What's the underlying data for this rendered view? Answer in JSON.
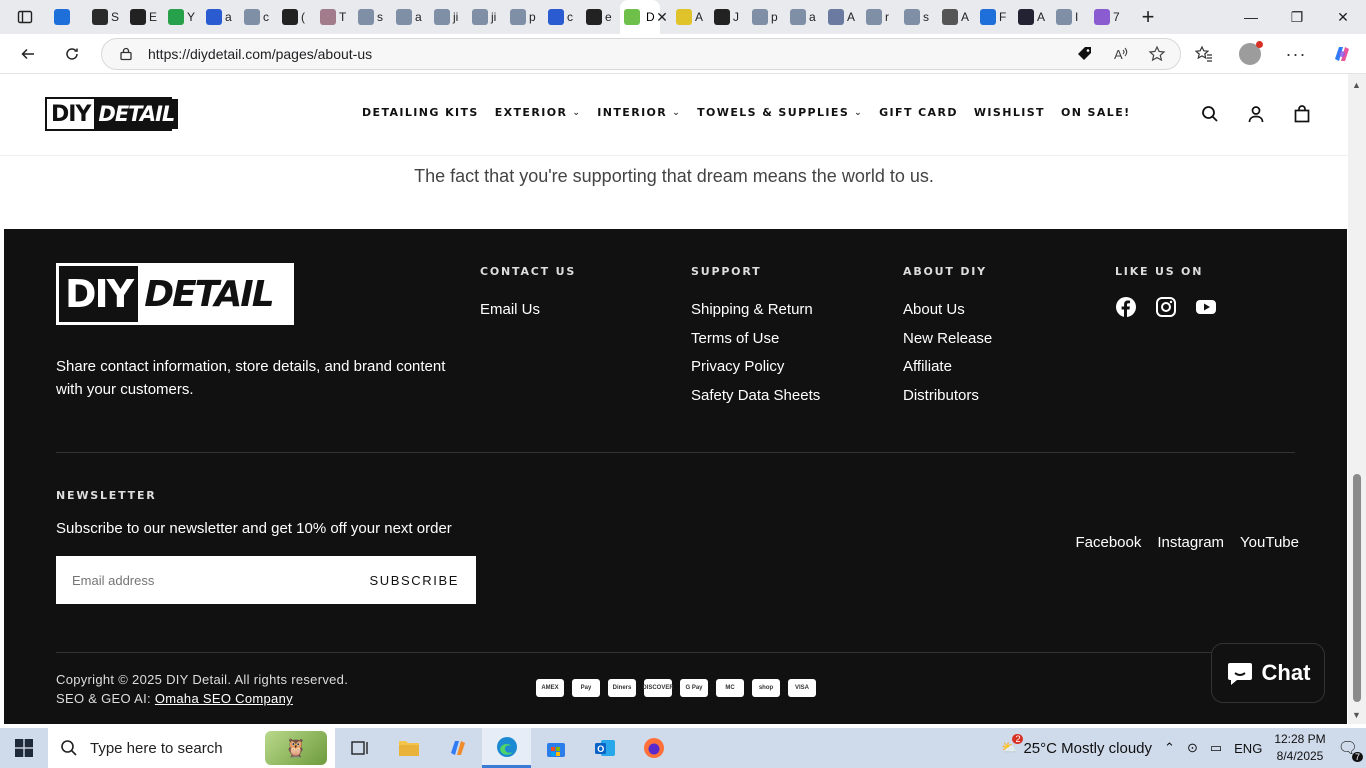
{
  "browser": {
    "url": "https://diydetail.com/pages/about-us",
    "active_tab_letter": "D",
    "tabs": [
      {
        "letter": "",
        "color": "#1e6fd9"
      },
      {
        "letter": "S",
        "color": "#2b2b2b"
      },
      {
        "letter": "E",
        "color": "#222"
      },
      {
        "letter": "Y",
        "color": "#27a04a"
      },
      {
        "letter": "a",
        "color": "#2b5bd1"
      },
      {
        "letter": "c",
        "color": "#7f8fa6"
      },
      {
        "letter": "(",
        "color": "#222"
      },
      {
        "letter": "T",
        "color": "#a37c8c"
      },
      {
        "letter": "s",
        "color": "#7f8fa6"
      },
      {
        "letter": "a",
        "color": "#7f8fa6"
      },
      {
        "letter": "ji",
        "color": "#7f8fa6"
      },
      {
        "letter": "ji",
        "color": "#7f8fa6"
      },
      {
        "letter": "p",
        "color": "#7f8fa6"
      },
      {
        "letter": "c",
        "color": "#2b5bd1"
      },
      {
        "letter": "e",
        "color": "#222"
      }
    ],
    "tabs_after": [
      {
        "letter": "A",
        "color": "#e0c32a"
      },
      {
        "letter": "J",
        "color": "#222"
      },
      {
        "letter": "p",
        "color": "#7f8fa6"
      },
      {
        "letter": "a",
        "color": "#7f8fa6"
      },
      {
        "letter": "A",
        "color": "#6a7aa0"
      },
      {
        "letter": "r",
        "color": "#7f8fa6"
      },
      {
        "letter": "s",
        "color": "#7f8fa6"
      },
      {
        "letter": "A",
        "color": "#555"
      },
      {
        "letter": "F",
        "color": "#1e6fd9"
      },
      {
        "letter": "A",
        "color": "#223"
      },
      {
        "letter": "I",
        "color": "#7f8fa6"
      },
      {
        "letter": "7",
        "color": "#8a5ccf"
      }
    ]
  },
  "site": {
    "nav": [
      {
        "label": "DETAILING KITS",
        "dropdown": false
      },
      {
        "label": "EXTERIOR",
        "dropdown": true
      },
      {
        "label": "INTERIOR",
        "dropdown": true
      },
      {
        "label": "TOWELS & SUPPLIES",
        "dropdown": true
      },
      {
        "label": "GIFT CARD",
        "dropdown": false
      },
      {
        "label": "WISHLIST",
        "dropdown": false
      },
      {
        "label": "ON SALE!",
        "dropdown": false
      }
    ],
    "logo": {
      "part1": "DIY",
      "part2": "DETAIL"
    },
    "tagline": "The fact that you're supporting that dream means the world to us."
  },
  "footer": {
    "description": "Share contact information, store details, and brand content with your customers.",
    "contact": {
      "heading": "CONTACT US",
      "links": [
        "Email Us"
      ]
    },
    "support": {
      "heading": "SUPPORT",
      "links": [
        "Shipping & Return",
        "Terms of Use",
        "Privacy Policy",
        "Safety Data Sheets"
      ]
    },
    "about": {
      "heading": "ABOUT DIY",
      "links": [
        "About Us",
        "New Release",
        "Affiliate",
        "Distributors"
      ]
    },
    "like": {
      "heading": "LIKE US ON"
    },
    "newsletter": {
      "heading": "NEWSLETTER",
      "text": "Subscribe to our newsletter and get 10% off your next order",
      "placeholder": "Email address",
      "button": "SUBSCRIBE"
    },
    "social_links": [
      "Facebook",
      "Instagram",
      "YouTube"
    ],
    "copyright": "Copyright © 2025 DIY Detail. All rights reserved.",
    "seo_prefix": "SEO & GEO AI:",
    "seo_link": "Omaha SEO Company",
    "payments": [
      "AMEX",
      "Pay",
      "Diners",
      "DISCOVER",
      "G Pay",
      "MC",
      "shop",
      "VISA"
    ],
    "chat": "Chat"
  },
  "taskbar": {
    "search_placeholder": "Type here to search",
    "weather": "25°C  Mostly cloudy",
    "weather_badge": "2",
    "lang": "ENG",
    "time": "12:28 PM",
    "date": "8/4/2025",
    "notif_count": "7"
  }
}
